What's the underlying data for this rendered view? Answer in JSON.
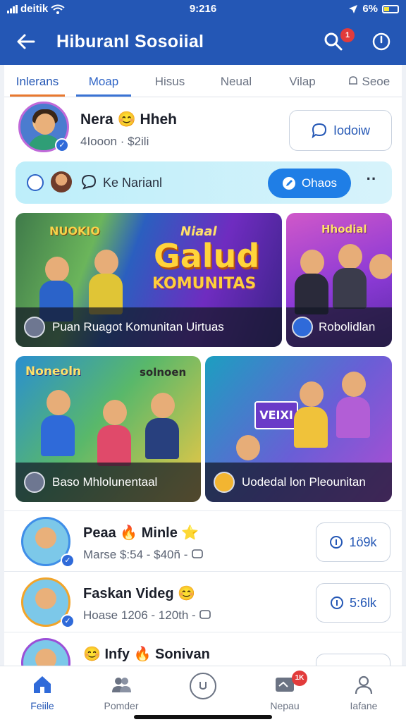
{
  "status_bar": {
    "carrier": "deitik",
    "time": "9:216",
    "battery": "6%"
  },
  "app_bar": {
    "title": "Hiburanl Sosoiial",
    "notification_count": "1"
  },
  "tabs": [
    {
      "label": "Inlerans"
    },
    {
      "label": "Moap"
    },
    {
      "label": "Hisus"
    },
    {
      "label": "Neual"
    },
    {
      "label": "Vilap"
    },
    {
      "label": "Seoe"
    }
  ],
  "profile": {
    "name": "Nera 😊 Hheh",
    "meta": "4Iooon  ·  $2ili",
    "button_label": "Iodoiw"
  },
  "action_bar": {
    "label": "Ke Narianl",
    "button_label": "Ohaos"
  },
  "cards": [
    {
      "headline_small": "Niaal",
      "headline_big": "Galud",
      "headline_sub": "KOMUNITAS",
      "corner_text": "NUOKIO",
      "caption": "Puan Ruagot Komunitan Uirtuas"
    },
    {
      "corner_text": "Hhodial",
      "caption": "Robolidlan"
    },
    {
      "corner_text": "Noneoln",
      "corner_text_2": "solnoen",
      "caption": "Baso Mhlolunentaal"
    },
    {
      "sign_text": "VEIXI",
      "caption": "Uodedal lon Pleounitan"
    }
  ],
  "list": [
    {
      "title": "Peaa 🔥 Minle ⭐",
      "meta": "Marse   $:54  -  $40ñ  -",
      "button_label": "1ö9k"
    },
    {
      "title": "Faskan Videg 😊",
      "meta": "Hoase   1206  -  120th  -",
      "button_label": "5:6lk"
    },
    {
      "title": "😊 Infy 🔥 Sonivan",
      "meta": "",
      "button_label": ""
    }
  ],
  "bottom_nav": [
    {
      "label": "Feiile"
    },
    {
      "label": "Pomder"
    },
    {
      "label": ""
    },
    {
      "label": "Nepau",
      "badge": "1K"
    },
    {
      "label": "Iafane"
    }
  ],
  "colors": {
    "primary": "#2457b5",
    "accent": "#1f7ee6",
    "tab_underline": "#e9782e"
  }
}
